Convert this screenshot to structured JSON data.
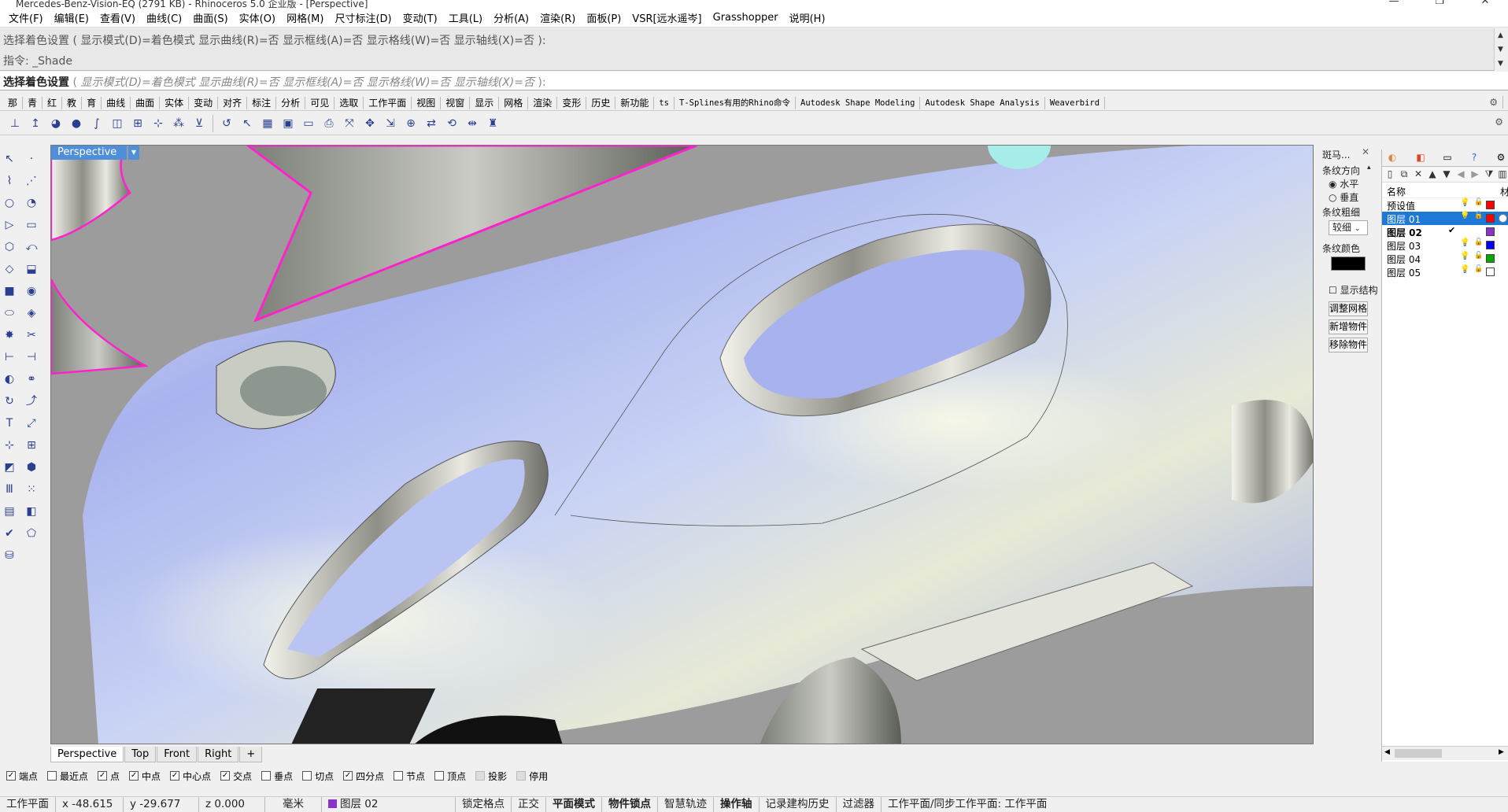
{
  "window": {
    "title": "Mercedes-Benz-Vision-EQ (2791 KB) - Rhinoceros  5.0 企业版 - [Perspective]",
    "controls": [
      "—",
      "❐",
      "✕"
    ]
  },
  "menu": [
    "文件(F)",
    "编辑(E)",
    "查看(V)",
    "曲线(C)",
    "曲面(S)",
    "实体(O)",
    "网格(M)",
    "尺寸标注(D)",
    "变动(T)",
    "工具(L)",
    "分析(A)",
    "渲染(R)",
    "面板(P)",
    "VSR[远水遥岑]",
    "Grasshopper",
    "说明(H)"
  ],
  "command": {
    "history_line1": "选择着色设置 ( 显示模式(D)=着色模式  显示曲线(R)=否  显示框线(A)=否  显示格线(W)=否  显示轴线(X)=否 ):",
    "history_line2": "指令: _Shade",
    "prompt_lead": "选择着色设置",
    "prompt_open": " ( ",
    "prompt_options": "显示模式(D)=着色模式  显示曲线(R)=否  显示框线(A)=否  显示格线(W)=否  显示轴线(X)=否",
    "prompt_close": " ):"
  },
  "toolbar_tabs": [
    "那",
    "青",
    "红",
    "教",
    "育",
    "曲线",
    "曲面",
    "实体",
    "变动",
    "对齐",
    "标注",
    "分析",
    "可见",
    "选取",
    "工作平面",
    "视图",
    "视窗",
    "显示",
    "网格",
    "渲染",
    "变形",
    "历史",
    "新功能",
    "ts",
    "T-Splines有用的Rhino命令",
    "Autodesk Shape Modeling",
    "Autodesk Shape Analysis",
    "Weaverbird"
  ],
  "viewport": {
    "name": "Perspective",
    "tabs": [
      "Perspective",
      "Top",
      "Front",
      "Right"
    ],
    "add_tab": "+"
  },
  "zebra": {
    "title": "斑马...",
    "direction_label": "条纹方向",
    "horizontal": "水平",
    "vertical": "垂直",
    "thickness_label": "条纹粗细",
    "thickness_value": "较细",
    "color_label": "条纹颜色",
    "color_value": "#000000",
    "show_structure": "显示结构",
    "buttons": [
      "调整网格",
      "新增物件",
      "移除物件"
    ]
  },
  "layers": {
    "header": "名称",
    "header_right": "材",
    "rows": [
      {
        "name": "预设值",
        "color": "#ff0000",
        "selected": false,
        "current": false,
        "bulb": "yellow"
      },
      {
        "name": "图层 01",
        "color": "#ff0000",
        "selected": true,
        "current": false,
        "bulb": "yellow"
      },
      {
        "name": "图层 02",
        "color": "#8833cc",
        "selected": false,
        "current": true,
        "bulb": ""
      },
      {
        "name": "图层 03",
        "color": "#0000ff",
        "selected": false,
        "current": false,
        "bulb": "blue"
      },
      {
        "name": "图层 04",
        "color": "#00aa00",
        "selected": false,
        "current": false,
        "bulb": "yellow"
      },
      {
        "name": "图层 05",
        "color": "#ffffff",
        "selected": false,
        "current": false,
        "bulb": "yellow"
      }
    ],
    "current_mark": "✔"
  },
  "osnaps": [
    {
      "label": "端点",
      "checked": true
    },
    {
      "label": "最近点",
      "checked": false
    },
    {
      "label": "点",
      "checked": true
    },
    {
      "label": "中点",
      "checked": true
    },
    {
      "label": "中心点",
      "checked": true
    },
    {
      "label": "交点",
      "checked": true
    },
    {
      "label": "垂点",
      "checked": false
    },
    {
      "label": "切点",
      "checked": false
    },
    {
      "label": "四分点",
      "checked": true
    },
    {
      "label": "节点",
      "checked": false
    },
    {
      "label": "顶点",
      "checked": false
    },
    {
      "label": "投影",
      "checked": false,
      "disabled": true
    },
    {
      "label": "停用",
      "checked": false,
      "disabled": true
    }
  ],
  "status": {
    "cplane": "工作平面",
    "x": "x -48.615",
    "y": "y -29.677",
    "z": "z 0.000",
    "units": "毫米",
    "layer": "图层 02",
    "layer_color": "#8833cc",
    "toggles": [
      {
        "label": "锁定格点",
        "bold": false
      },
      {
        "label": "正交",
        "bold": false
      },
      {
        "label": "平面模式",
        "bold": true
      },
      {
        "label": "物件锁点",
        "bold": true
      },
      {
        "label": "智慧轨迹",
        "bold": false
      },
      {
        "label": "操作轴",
        "bold": true
      },
      {
        "label": "记录建构历史",
        "bold": false
      },
      {
        "label": "过滤器",
        "bold": false
      }
    ],
    "message": "工作平面/同步工作平面: 工作平面"
  }
}
